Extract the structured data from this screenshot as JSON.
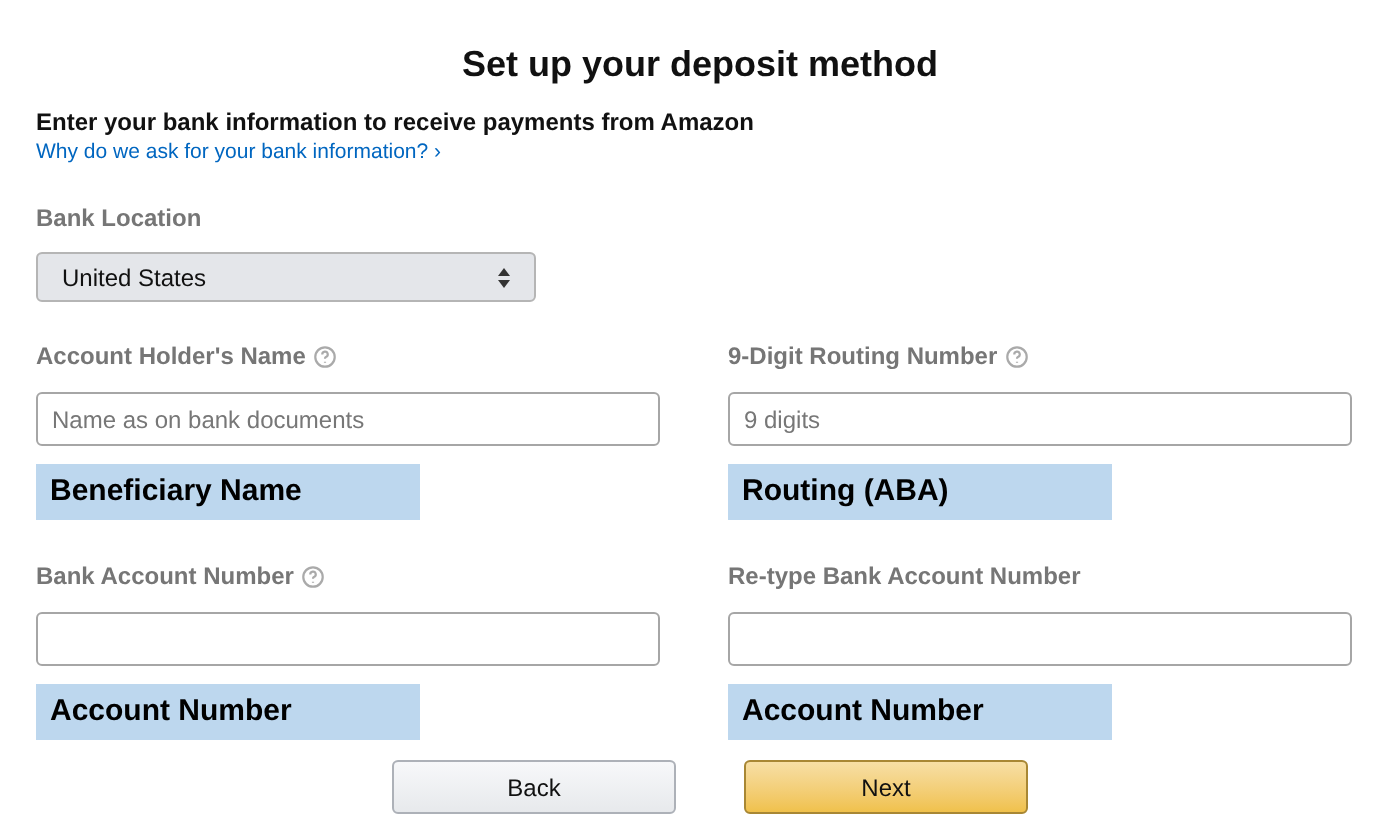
{
  "title": "Set up your deposit method",
  "intro": "Enter your bank information to receive payments from Amazon",
  "help_link": "Why do we ask for your bank information? ›",
  "bank_location": {
    "label": "Bank Location",
    "value": "United States"
  },
  "field_rows": [
    [
      {
        "label": "Account Holder's Name",
        "help": true,
        "placeholder": "Name as on bank documents",
        "annotation": "Beneficiary Name"
      },
      {
        "label": "9-Digit Routing Number",
        "help": true,
        "placeholder": "9 digits",
        "annotation": "Routing (ABA)"
      }
    ],
    [
      {
        "label": "Bank Account Number",
        "help": true,
        "annotation": "Account Number"
      },
      {
        "label": "Re-type Bank Account Number",
        "help": false,
        "annotation": "Account Number"
      }
    ]
  ],
  "buttons": [
    {
      "label": "Back",
      "kind": "secondary"
    },
    {
      "label": "Next",
      "kind": "primary"
    }
  ]
}
